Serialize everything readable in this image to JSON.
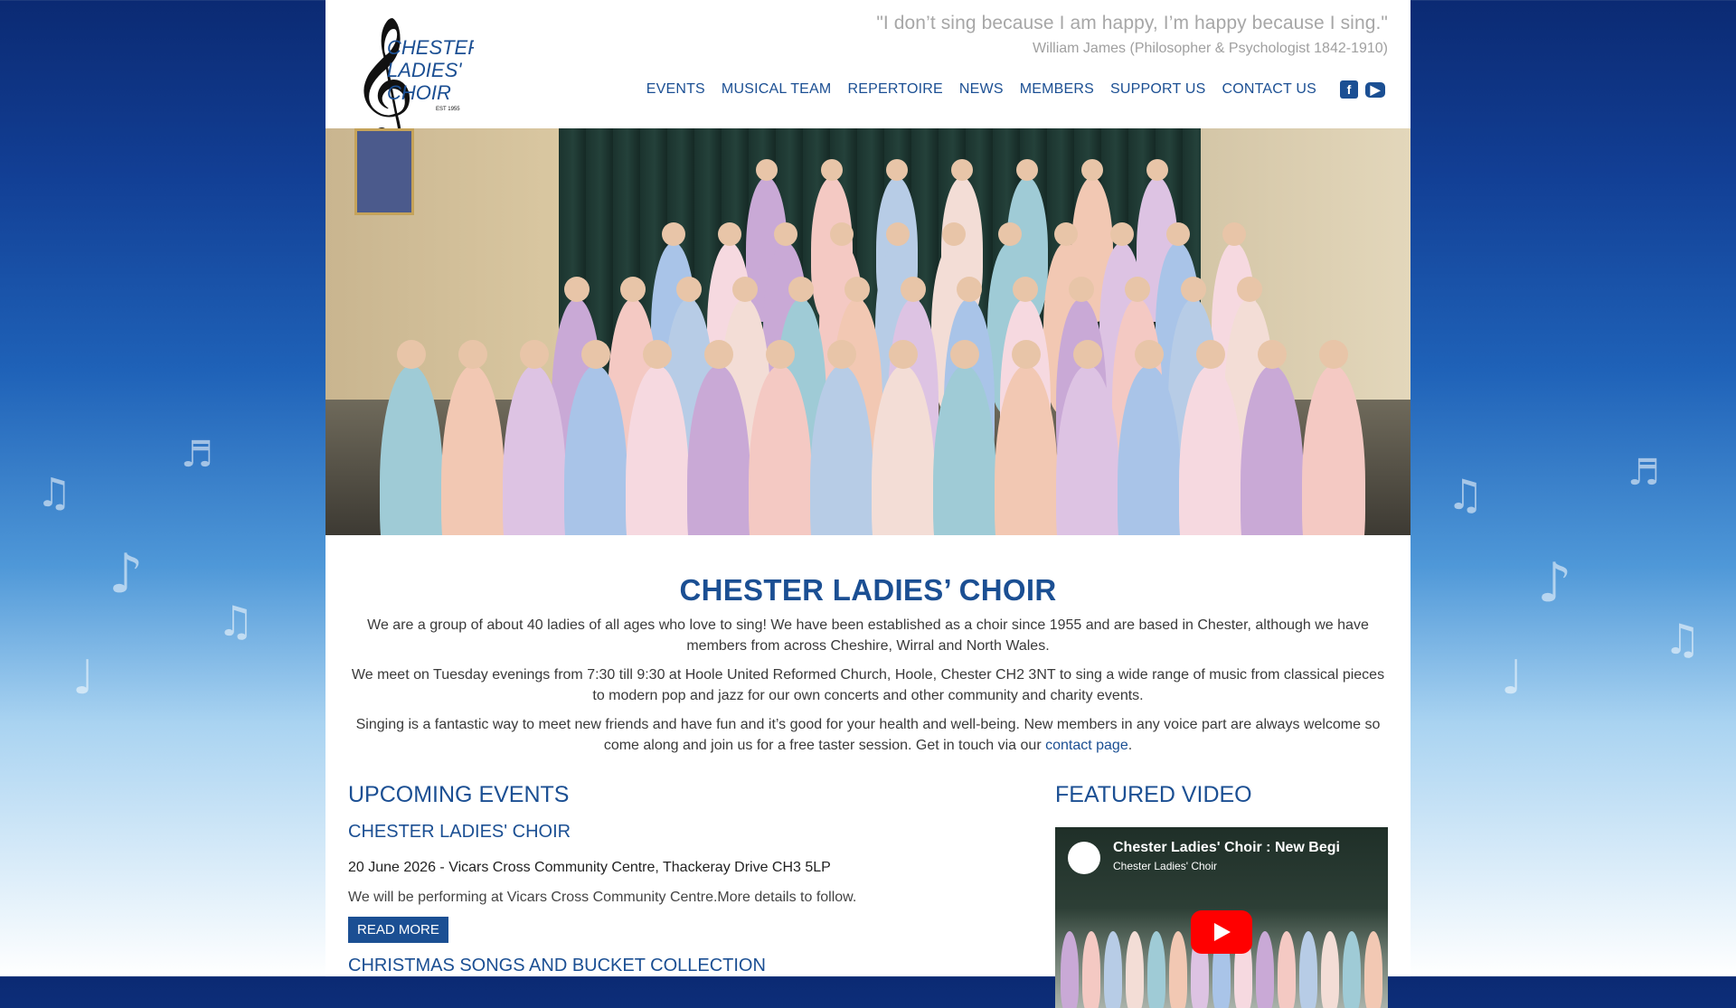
{
  "header": {
    "logo_line1": "CHESTER",
    "logo_line2": "LADIES'",
    "logo_line3": "CHOIR",
    "logo_est": "EST 1955",
    "quote": "\"I don’t sing because I am happy, I’m happy because I sing.\"",
    "quote_author": "William James (Philosopher & Psychologist 1842-1910)"
  },
  "nav": {
    "items": [
      "EVENTS",
      "MUSICAL TEAM",
      "REPERTOIRE",
      "NEWS",
      "MEMBERS",
      "SUPPORT US",
      "CONTACT US"
    ],
    "facebook_icon": "facebook-icon",
    "youtube_icon": "youtube-icon"
  },
  "main": {
    "title": "CHESTER LADIES’ CHOIR",
    "para1": "We are a group of about 40 ladies of all ages who love to sing! We have been established as a choir since 1955 and are based in Chester, although we have members from across Cheshire, Wirral and North Wales.",
    "para2": "We meet on Tuesday evenings from 7:30 till 9:30 at Hoole United Reformed Church, Hoole, Chester CH2 3NT to sing a wide range of music from classical pieces to modern pop and jazz for our own concerts and other community and charity events.",
    "para3_before": "Singing is a fantastic way to meet new friends and have fun and it’s good for your health and well-being. New members in any voice part are always welcome so come along and join us for a free taster session. Get in touch via our ",
    "para3_link": "contact page",
    "para3_after": "."
  },
  "events": {
    "heading": "UPCOMING EVENTS",
    "event1_title": "CHESTER LADIES' CHOIR",
    "event1_date": "20 June 2026 - Vicars Cross Community Centre, Thackeray Drive CH3 5LP",
    "event1_desc": "We will be performing at Vicars Cross Community Centre.More details to follow.",
    "read_more": "READ MORE",
    "event2_title": "CHRISTMAS SONGS AND BUCKET COLLECTION"
  },
  "video": {
    "heading": "FEATURED VIDEO",
    "title": "Chester Ladies' Choir : New Begi",
    "channel": "Chester Ladies' Choir"
  },
  "colors": {
    "brand_blue": "#1b4f93",
    "quote_gray": "#a7a7a7",
    "youtube_red": "#ff0000"
  }
}
